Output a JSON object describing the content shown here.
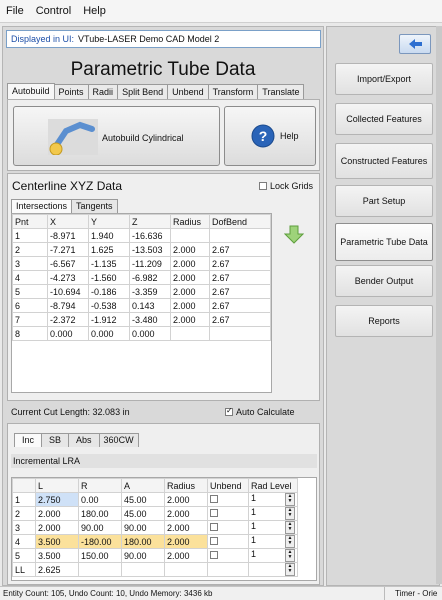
{
  "menu": [
    "File",
    "Control",
    "Help"
  ],
  "displayed": {
    "label": "Displayed in UI:",
    "value": "VTube-LASER Demo CAD Model 2"
  },
  "title": "Parametric Tube Data",
  "tabs": [
    "Autobuild",
    "Points",
    "Radii",
    "Split Bend",
    "Unbend",
    "Transform",
    "Translate"
  ],
  "autobuild_button": "Autobuild Cylindrical",
  "help_button": "Help",
  "centerline": {
    "title": "Centerline XYZ Data",
    "lock_grids": "Lock Grids",
    "subtabs": [
      "Intersections",
      "Tangents"
    ],
    "headers": [
      "Pnt",
      "X",
      "Y",
      "Z",
      "Radius",
      "DofBend"
    ],
    "rows": [
      [
        "1",
        "-8.971",
        "1.940",
        "-16.636",
        "",
        ""
      ],
      [
        "2",
        "-7.271",
        "1.625",
        "-13.503",
        "2.000",
        "2.67"
      ],
      [
        "3",
        "-6.567",
        "-1.135",
        "-11.209",
        "2.000",
        "2.67"
      ],
      [
        "4",
        "-4.273",
        "-1.560",
        "-6.982",
        "2.000",
        "2.67"
      ],
      [
        "5",
        "-10.694",
        "-0.186",
        "-3.359",
        "2.000",
        "2.67"
      ],
      [
        "6",
        "-8.794",
        "-0.538",
        "0.143",
        "2.000",
        "2.67"
      ],
      [
        "7",
        "-2.372",
        "-1.912",
        "-3.480",
        "2.000",
        "2.67"
      ],
      [
        "8",
        "0.000",
        "0.000",
        "0.000",
        "",
        ""
      ]
    ]
  },
  "cut_length": "Current Cut Length:  32.083 in",
  "auto_calculate": "Auto Calculate",
  "lower_tabs": [
    "Inc",
    "SB",
    "Abs",
    "360CW"
  ],
  "lra": {
    "title": "Incremental LRA",
    "headers": [
      "",
      "L",
      "R",
      "A",
      "Radius",
      "Unbend",
      "Rad Level"
    ],
    "rows": [
      [
        "1",
        "2.750",
        "0.00",
        "45.00",
        "2.000",
        "",
        "1"
      ],
      [
        "2",
        "2.000",
        "180.00",
        "45.00",
        "2.000",
        "",
        "1"
      ],
      [
        "3",
        "2.000",
        "90.00",
        "90.00",
        "2.000",
        "",
        "1"
      ],
      [
        "4",
        "3.500",
        "-180.00",
        "180.00",
        "2.000",
        "",
        "1"
      ],
      [
        "5",
        "3.500",
        "150.00",
        "90.00",
        "2.000",
        "",
        "1"
      ],
      [
        "LL",
        "2.625",
        "",
        "",
        "",
        "",
        ""
      ]
    ]
  },
  "right_buttons": [
    "Import/Export",
    "Collected Features",
    "Constructed Features",
    "Part Setup",
    "Parametric Tube Data",
    "Bender Output",
    "Reports"
  ],
  "status": {
    "left": "Entity Count: 105, Undo Count: 10, Undo Memory: 3436 kb",
    "right": "Timer - Orie"
  }
}
